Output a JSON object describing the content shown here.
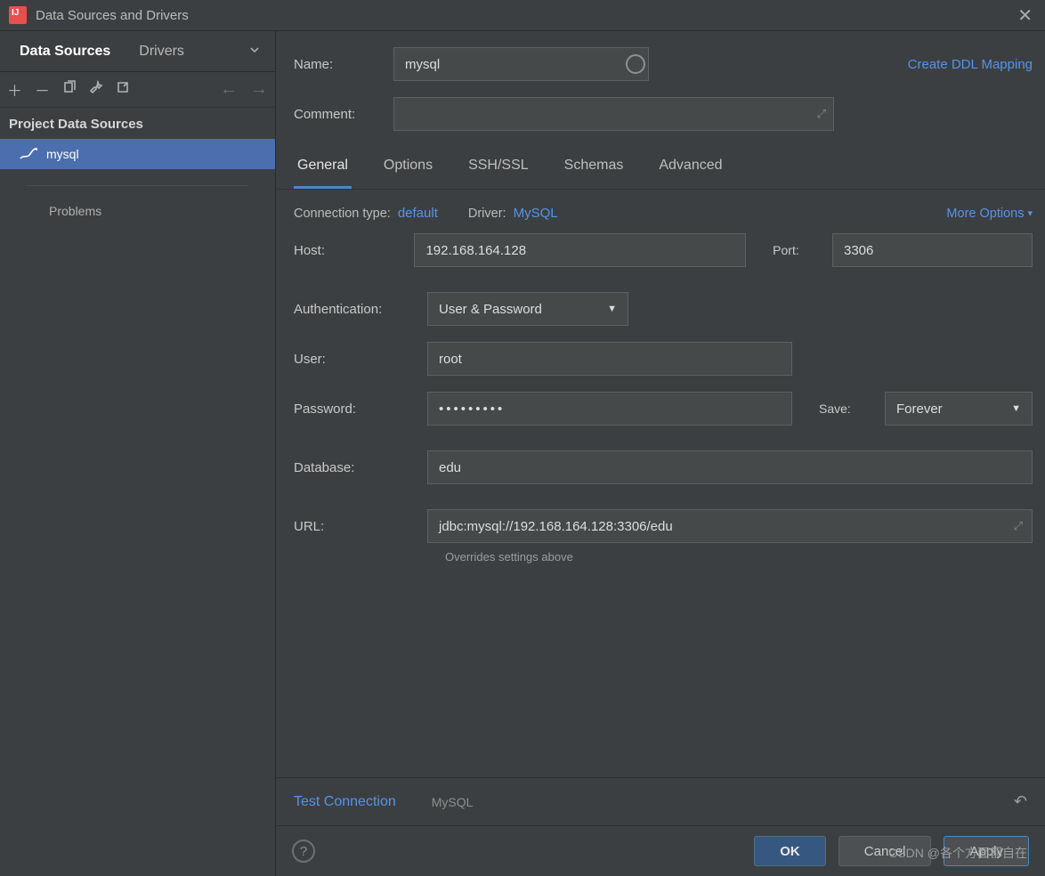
{
  "window": {
    "title": "Data Sources and Drivers"
  },
  "sidebar": {
    "tabs": {
      "data_sources": "Data Sources",
      "drivers": "Drivers"
    },
    "section_label": "Project Data Sources",
    "items": [
      {
        "label": "mysql"
      }
    ],
    "problems_label": "Problems"
  },
  "form": {
    "name_label": "Name:",
    "name_value": "mysql",
    "comment_label": "Comment:",
    "create_ddl": "Create DDL Mapping"
  },
  "tabs": {
    "general": "General",
    "options": "Options",
    "ssh": "SSH/SSL",
    "schemas": "Schemas",
    "advanced": "Advanced"
  },
  "conn": {
    "type_label": "Connection type:",
    "type_value": "default",
    "driver_label": "Driver:",
    "driver_value": "MySQL",
    "more_options": "More Options"
  },
  "fields": {
    "host_label": "Host:",
    "host_value": "192.168.164.128",
    "port_label": "Port:",
    "port_value": "3306",
    "auth_label": "Authentication:",
    "auth_value": "User & Password",
    "user_label": "User:",
    "user_value": "root",
    "password_label": "Password:",
    "password_value": "•••••••••",
    "save_label": "Save:",
    "save_value": "Forever",
    "database_label": "Database:",
    "database_value": "edu",
    "url_label": "URL:",
    "url_value": "jdbc:mysql://192.168.164.128:3306/edu",
    "url_hint": "Overrides settings above"
  },
  "footer": {
    "test_connection": "Test Connection",
    "driver_name": "MySQL",
    "ok": "OK",
    "cancel": "Cancel",
    "apply": "Apply",
    "watermark": "CSDN @各个方面都自在"
  }
}
